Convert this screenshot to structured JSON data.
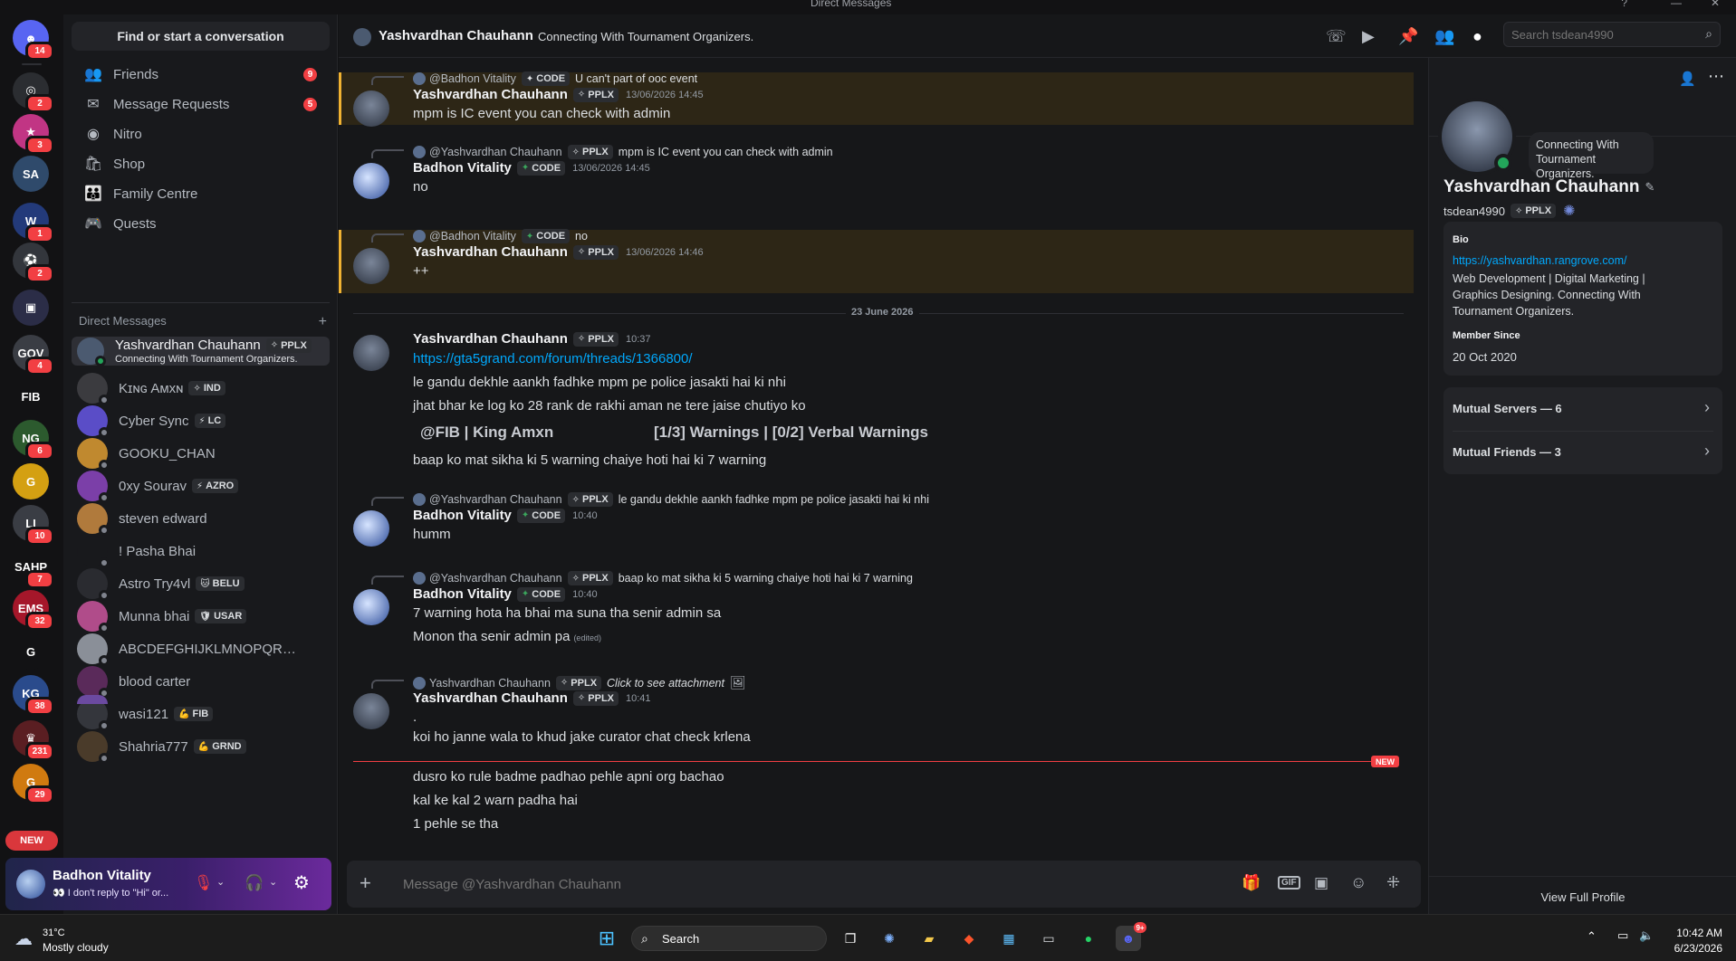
{
  "window": {
    "title": "Direct Messages"
  },
  "guilds": [
    {
      "name": "home",
      "badge": "14",
      "color": "#5865f2",
      "label": "☻"
    },
    {
      "name": "server-1",
      "badge": "2",
      "color": "#2b2d31",
      "label": "◎"
    },
    {
      "name": "server-2",
      "badge": "3",
      "color": "#c13584",
      "label": "★"
    },
    {
      "name": "server-san-andreas",
      "badge": "",
      "color": "#2f4a6b",
      "label": "SA"
    },
    {
      "name": "server-w",
      "badge": "1",
      "color": "#233a7a",
      "label": "W"
    },
    {
      "name": "server-soccer",
      "badge": "2",
      "color": "#33363c",
      "label": "⚽"
    },
    {
      "name": "folder",
      "badge": "",
      "color": "#2b2d47",
      "label": "▣"
    },
    {
      "name": "server-gov",
      "badge": "4",
      "color": "#3a3d44",
      "label": "GOV"
    },
    {
      "name": "server-fib",
      "badge": "",
      "color": "#121214",
      "label": "FIB"
    },
    {
      "name": "server-national-guard",
      "badge": "6",
      "color": "#2c5a2e",
      "label": "NG"
    },
    {
      "name": "server-g",
      "badge": "",
      "color": "#d4a012",
      "label": "G"
    },
    {
      "name": "server-lifeinvader",
      "badge": "10",
      "color": "#3a3d44",
      "label": "LI"
    },
    {
      "name": "server-sahp",
      "badge": "7",
      "color": "#121214",
      "label": "SAHP"
    },
    {
      "name": "server-ems",
      "badge": "32",
      "color": "#a5172a",
      "label": "EMS"
    },
    {
      "name": "server-g2",
      "badge": "",
      "color": "#121214",
      "label": "G"
    },
    {
      "name": "server-kg",
      "badge": "38",
      "color": "#2a4b8c",
      "label": "KG"
    },
    {
      "name": "server-231",
      "badge": "231",
      "color": "#5a1e22",
      "label": "♛"
    },
    {
      "name": "server-29",
      "badge": "29",
      "color": "#d07a10",
      "label": "G"
    }
  ],
  "new_pill": "NEW",
  "sidebar": {
    "find": "Find or start a conversation",
    "nav": [
      {
        "label": "Friends",
        "icon": "👥",
        "badge": "9"
      },
      {
        "label": "Message Requests",
        "icon": "✉",
        "badge": "5"
      },
      {
        "label": "Nitro",
        "icon": "◉",
        "badge": ""
      },
      {
        "label": "Shop",
        "icon": "🛍",
        "badge": ""
      },
      {
        "label": "Family Centre",
        "icon": "👪",
        "badge": ""
      },
      {
        "label": "Quests",
        "icon": "🎮",
        "badge": ""
      }
    ],
    "dm_header": "Direct Messages",
    "dms": [
      {
        "name": "Yashvardhan Chauhann",
        "tag": "PPLX",
        "tagicon": "✧",
        "sub": "Connecting With Tournament Organizers.",
        "color": "#4b5a70",
        "selected": true
      },
      {
        "name": "Kɪɴɢ Aᴍxɴ",
        "tag": "IND",
        "tagicon": "✧",
        "sub": "",
        "color": "#3b3b3f"
      },
      {
        "name": "Cyber Sync",
        "tag": "LC",
        "tagicon": "⚡",
        "sub": "",
        "color": "#5a4dc7"
      },
      {
        "name": "GOOKU_CHAN",
        "tag": "",
        "tagicon": "",
        "sub": "",
        "color": "#c0892f"
      },
      {
        "name": "0xy Sourav",
        "tag": "AZRO",
        "tagicon": "⚡",
        "sub": "",
        "color": "#7b3fa8"
      },
      {
        "name": "steven edward",
        "tag": "",
        "tagicon": "",
        "sub": "",
        "color": "#b07a3c"
      },
      {
        "name": "! Pasha Bhai",
        "tag": "",
        "tagicon": "",
        "sub": "",
        "color": "#18191c"
      },
      {
        "name": "Astro Try4vl",
        "tag": "BELU",
        "tagicon": "🐱",
        "sub": "",
        "color": "#2a2b30"
      },
      {
        "name": "Munna bhai",
        "tag": "USAR",
        "tagicon": "🛡",
        "sub": "",
        "color": "#b04c8a"
      },
      {
        "name": "ABCDEFGHIJKLMNOPQRSTUV...",
        "tag": "",
        "tagicon": "",
        "sub": "",
        "color": "#8a8f98"
      },
      {
        "name": "blood carter",
        "tag": "",
        "tagicon": "",
        "sub": "",
        "color": "#5a2a5a"
      },
      {
        "name": "wasi121",
        "tag": "FIB",
        "tagicon": "💪",
        "sub": "",
        "color": "#34363c"
      },
      {
        "name": "Shahria777",
        "tag": "GRND",
        "tagicon": "💪",
        "sub": "",
        "color": "#4a3b2a"
      }
    ]
  },
  "user_panel": {
    "name": "Badhon Vitality",
    "status": "👀 I don't reply to \"Hi\" or..."
  },
  "header": {
    "name": "Yashvardhan Chauhann",
    "status": "Connecting With Tournament Organizers.",
    "search_placeholder": "Search tsdean4990"
  },
  "chat": {
    "m1": {
      "reply_name": "@Badhon Vitality",
      "reply_tag": "CODE",
      "reply_text": "U can't part of ooc event",
      "user": "Yashvardhan Chauhann",
      "tag": "PPLX",
      "time": "13/06/2026 14:45",
      "lines": [
        "mpm is IC event you can check with admin"
      ]
    },
    "m2": {
      "reply_name": "@Yashvardhan Chauhann",
      "reply_tag": "PPLX",
      "reply_text": "mpm is IC event you can check with admin",
      "user": "Badhon Vitality",
      "tag": "CODE",
      "time": "13/06/2026 14:45",
      "lines": [
        "no"
      ]
    },
    "m3": {
      "reply_name": "@Badhon Vitality",
      "reply_tag": "CODE",
      "reply_text": "no",
      "user": "Yashvardhan Chauhann",
      "tag": "PPLX",
      "time": "13/06/2026 14:46",
      "lines": [
        "++"
      ]
    },
    "divider": "23 June 2026",
    "m4": {
      "user": "Yashvardhan Chauhann",
      "tag": "PPLX",
      "time": "10:37",
      "link": "https://gta5grand.com/forum/threads/1366800/",
      "lines": [
        "le gandu dekhle aankh fadhke mpm pe police jasakti hai ki nhi",
        "jhat bhar ke log ko 28 rank de rakhi aman ne tere jaise chutiyo ko"
      ],
      "embed_left": "@FIB | King Amxn",
      "embed_right": "[1/3] Warnings | [0/2] Verbal Warnings",
      "last": "baap ko mat sikha ki 5 warning chaiye hoti hai ki 7 warning"
    },
    "m5": {
      "reply_name": "@Yashvardhan Chauhann",
      "reply_tag": "PPLX",
      "reply_text": "le gandu dekhle aankh fadhke mpm pe police jasakti hai ki nhi",
      "user": "Badhon Vitality",
      "tag": "CODE",
      "time": "10:40",
      "lines": [
        "humm"
      ]
    },
    "m6": {
      "reply_name": "@Yashvardhan Chauhann",
      "reply_tag": "PPLX",
      "reply_text": "baap ko mat sikha ki 5 warning chaiye hoti hai ki 7 warning",
      "user": "Badhon Vitality",
      "tag": "CODE",
      "time": "10:40",
      "lines": [
        "7 warning hota ha bhai ma suna tha senir admin sa",
        "Monon tha senir admin pa"
      ],
      "edited": "(edited)"
    },
    "m7": {
      "reply_name": "Yashvardhan Chauhann",
      "reply_tag": "PPLX",
      "reply_text": "Click to see attachment",
      "user": "Yashvardhan Chauhann",
      "tag": "PPLX",
      "time": "10:41",
      "lines": [
        ".",
        "koi ho janne wala to khud jake curator chat check krlena"
      ],
      "after_new": [
        "dusro ko rule badme padhao pehle apni org bachao",
        "kal ke kal 2 warn padha hai",
        "1 pehle se tha"
      ]
    },
    "new_label": "NEW",
    "composer_placeholder": "Message @Yashvardhan Chauhann"
  },
  "profile": {
    "status_bubble": "Connecting With Tournament Organizers.",
    "name": "Yashvardhan Chauhann",
    "username": "tsdean4990",
    "tag": "PPLX",
    "bio_label": "Bio",
    "bio_link": "https://yashvardhan.rangrove.com/",
    "bio_text": [
      "Web Development | Digital Marketing |",
      "Graphics Designing. Connecting With",
      "Tournament Organizers."
    ],
    "member_since_label": "Member Since",
    "member_since": "20 Oct 2020",
    "mutual_servers": "Mutual Servers — 6",
    "mutual_friends": "Mutual Friends — 3",
    "view_full": "View Full Profile"
  },
  "taskbar": {
    "temp": "31°C",
    "weather": "Mostly cloudy",
    "search": "Search",
    "time": "10:42 AM",
    "date": "6/23/2026",
    "discord_badge": "9+"
  },
  "colors": {
    "accent": "#5865f2",
    "mention_bg": "#2d2616",
    "mention_bar": "#f0b232",
    "danger": "#f23f43",
    "link": "#00a8fc"
  }
}
